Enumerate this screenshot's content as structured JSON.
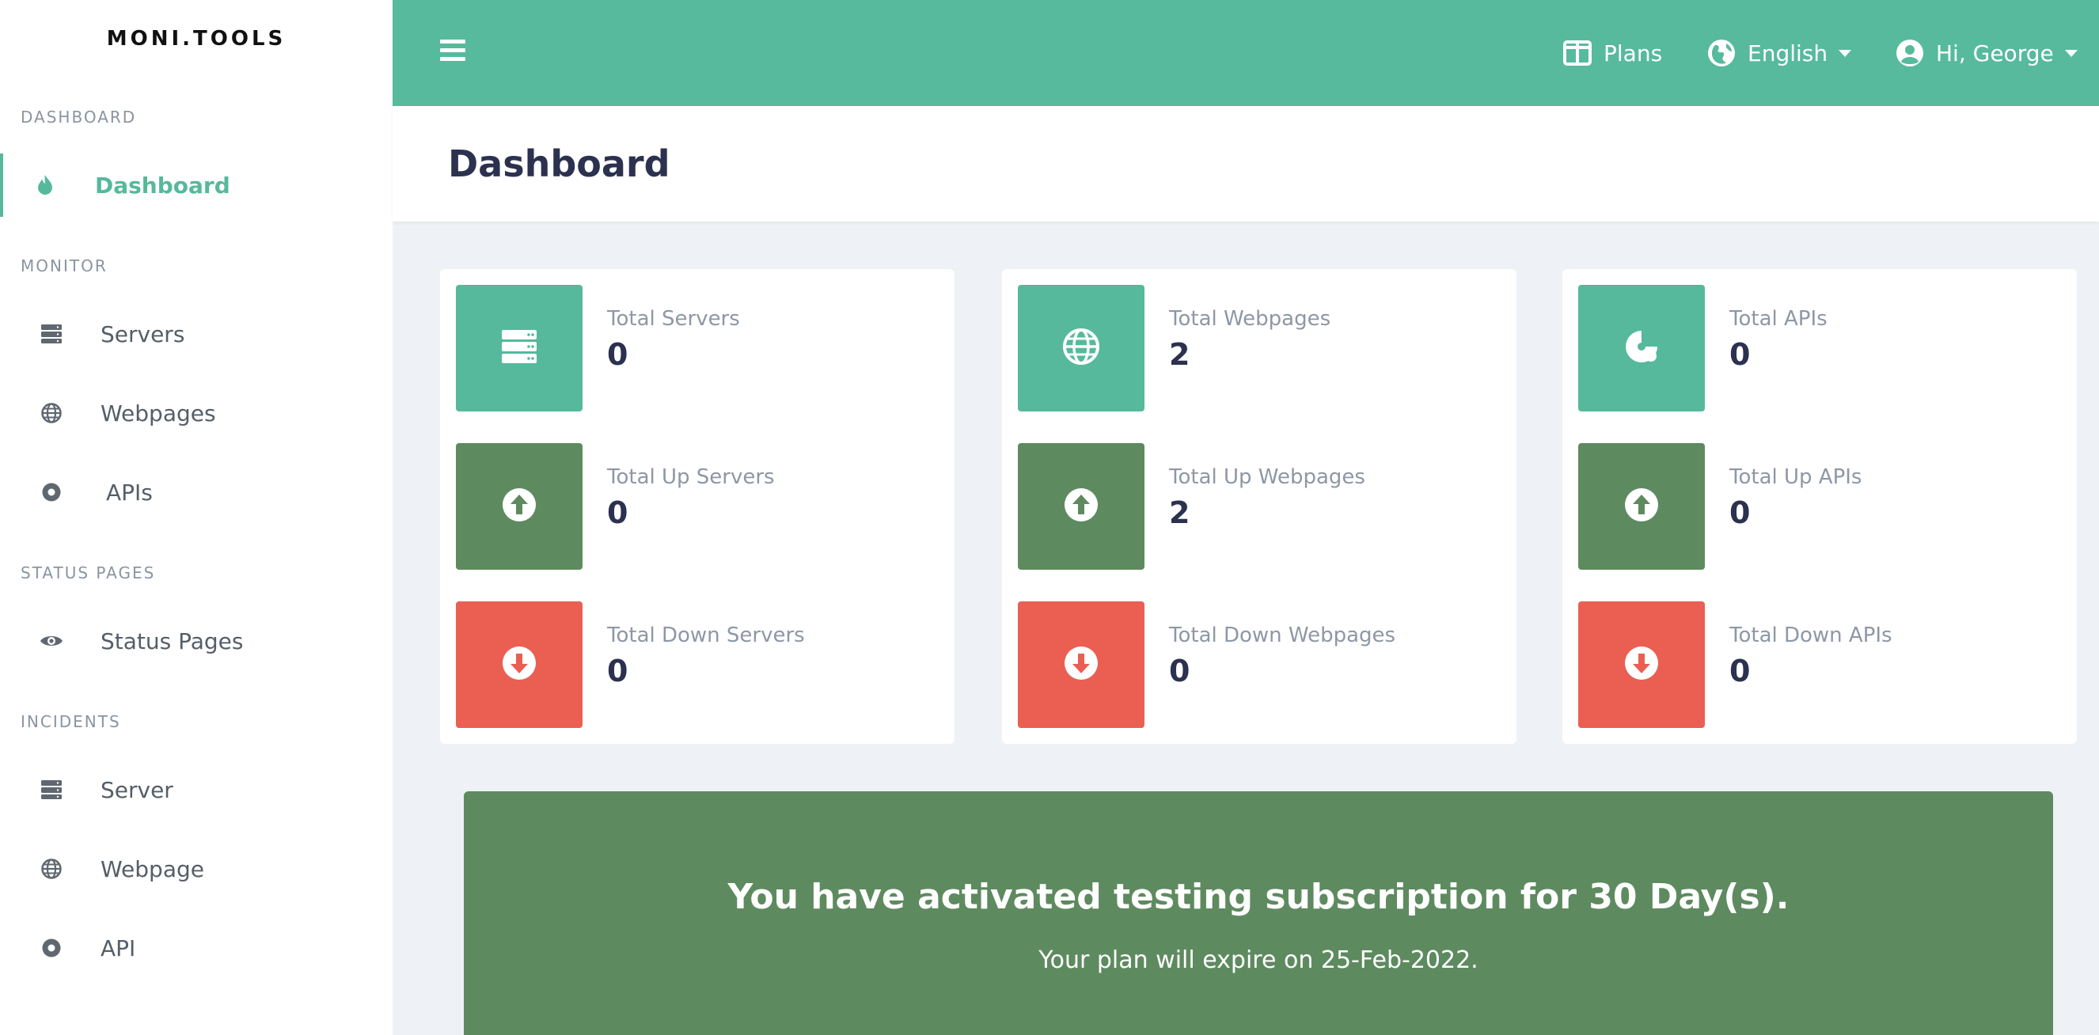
{
  "brand": "MONI.TOOLS",
  "sidebar": {
    "sections": [
      {
        "label": "DASHBOARD",
        "items": [
          {
            "label": "Dashboard",
            "icon": "fire-icon",
            "active": true
          }
        ]
      },
      {
        "label": "MONITOR",
        "items": [
          {
            "label": "Servers",
            "icon": "server-icon"
          },
          {
            "label": "Webpages",
            "icon": "globe-icon"
          },
          {
            "label": "APIs",
            "icon": "api-icon"
          }
        ]
      },
      {
        "label": "STATUS PAGES",
        "items": [
          {
            "label": "Status Pages",
            "icon": "eye-icon"
          }
        ]
      },
      {
        "label": "INCIDENTS",
        "items": [
          {
            "label": "Server",
            "icon": "server-icon"
          },
          {
            "label": "Webpage",
            "icon": "globe-icon"
          },
          {
            "label": "API",
            "icon": "api-icon"
          }
        ]
      }
    ]
  },
  "topbar": {
    "menu_icon": "hamburger-icon",
    "plans": "Plans",
    "language": "English",
    "user": "Hi, George"
  },
  "page": {
    "title": "Dashboard"
  },
  "cards": [
    {
      "stats": [
        {
          "label": "Total Servers",
          "value": "0",
          "icon": "server-icon",
          "color": "#56b99c"
        },
        {
          "label": "Total Up Servers",
          "value": "0",
          "icon": "arrow-up-circle-icon",
          "color": "#5e8a5f"
        },
        {
          "label": "Total Down Servers",
          "value": "0",
          "icon": "arrow-down-circle-icon",
          "color": "#ea5f52"
        }
      ]
    },
    {
      "stats": [
        {
          "label": "Total Webpages",
          "value": "2",
          "icon": "globe-icon",
          "color": "#56b99c"
        },
        {
          "label": "Total Up Webpages",
          "value": "2",
          "icon": "arrow-up-circle-icon",
          "color": "#5e8a5f"
        },
        {
          "label": "Total Down Webpages",
          "value": "0",
          "icon": "arrow-down-circle-icon",
          "color": "#ea5f52"
        }
      ]
    },
    {
      "stats": [
        {
          "label": "Total APIs",
          "value": "0",
          "icon": "api-icon",
          "color": "#56b99c"
        },
        {
          "label": "Total Up APIs",
          "value": "0",
          "icon": "arrow-up-circle-icon",
          "color": "#5e8a5f"
        },
        {
          "label": "Total Down APIs",
          "value": "0",
          "icon": "arrow-down-circle-icon",
          "color": "#ea5f52"
        }
      ]
    }
  ],
  "banner": {
    "title": "You have activated testing subscription for 30 Day(s).",
    "subtitle": "Your plan will expire on 25-Feb-2022."
  },
  "colors": {
    "accent": "#57ba9d",
    "up": "#5e8a5f",
    "down": "#ea5f52",
    "title": "#2c3150"
  }
}
